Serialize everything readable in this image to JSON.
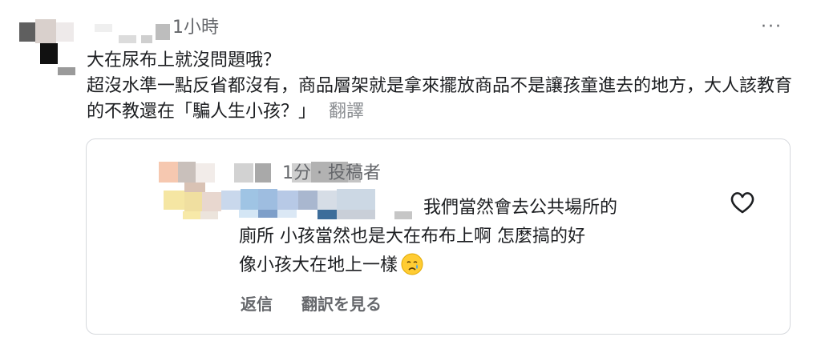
{
  "comment": {
    "time": "1小時",
    "more_label": "···",
    "line1": "大在尿布上就沒問題哦？",
    "line2": "超沒水準一點反省都沒有，商品層架就是拿來擺放商品不是讓孩童進去的地方，大人該教育的不教還在「騙人生小孩？」",
    "translate_label": "翻譯"
  },
  "reply": {
    "meta": "1分 · 投稿者",
    "line1": "我們當然會去公共場所的",
    "line2": "廁所 小孩當然也是大在布布上啊 怎麼搞的好",
    "line3": "像小孩大在地上一樣",
    "emoji_icon": "crying-face-icon",
    "like_icon": "heart-outline-icon",
    "reply_label": "返信",
    "translate_label": "翻訳を見る"
  },
  "colors": {
    "text": "#1c1e21",
    "secondary": "#65676b",
    "muted": "#8a8d91",
    "card_border": "#d6d9dd"
  }
}
